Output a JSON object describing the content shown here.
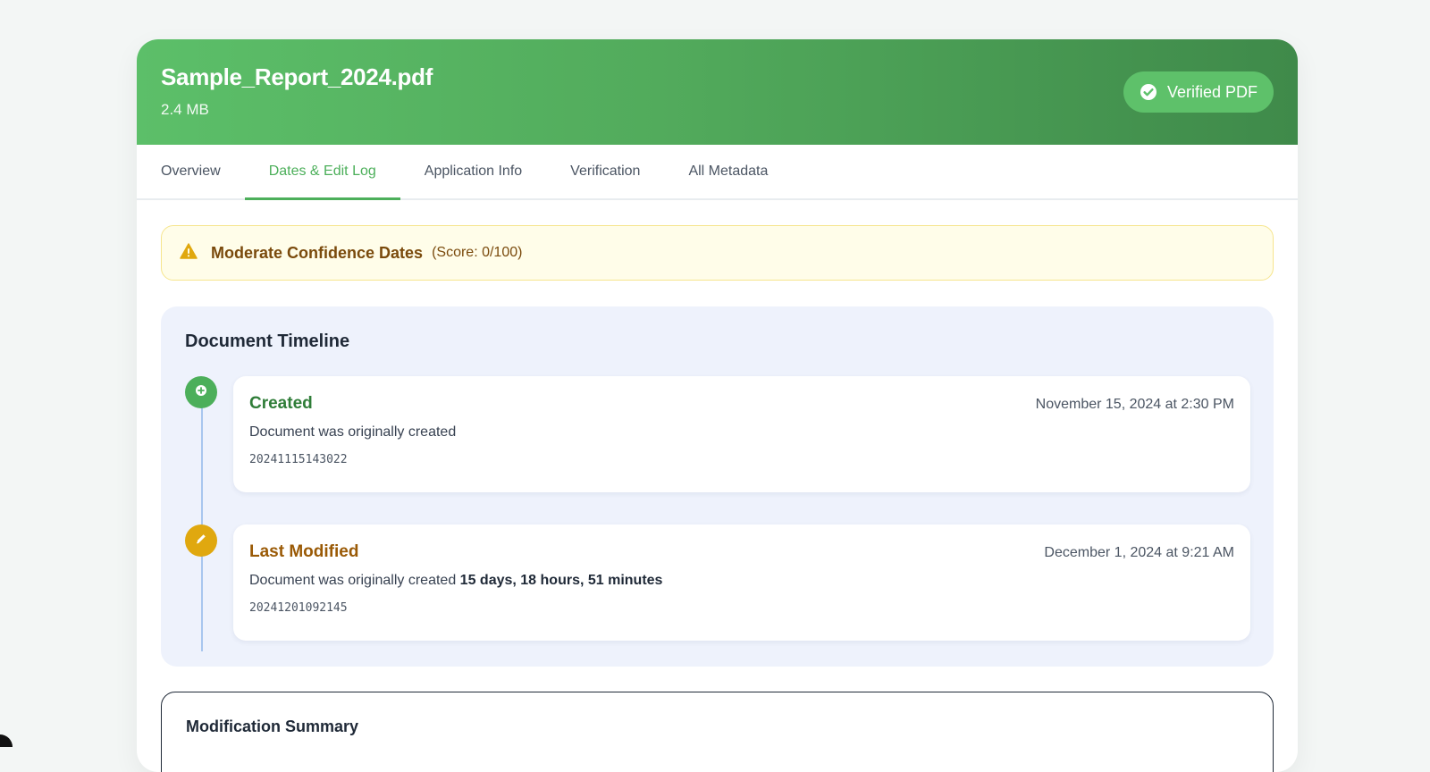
{
  "header": {
    "file_name": "Sample_Report_2024.pdf",
    "file_size": "2.4 MB",
    "badge_label": "Verified PDF",
    "badge_icon": "check-circle-icon",
    "colors": {
      "accent": "#4caf5a",
      "gradient_start": "#5cbf69",
      "gradient_end": "#3f8a4a"
    }
  },
  "tabs": [
    {
      "label": "Overview",
      "active": false
    },
    {
      "label": "Dates & Edit Log",
      "active": true
    },
    {
      "label": "Application Info",
      "active": false
    },
    {
      "label": "Verification",
      "active": false
    },
    {
      "label": "All Metadata",
      "active": false
    }
  ],
  "alert": {
    "icon": "warning-icon",
    "title": "Moderate Confidence Dates",
    "score": "(Score: 0/100)",
    "color": "#7a4a0c"
  },
  "timeline": {
    "heading": "Document Timeline",
    "events": [
      {
        "title": "Created",
        "icon": "plus-circle-icon",
        "date": "November 15, 2024 at 2:30 PM",
        "description": "Document was originally created",
        "description_bold": "",
        "raw": "20241115143022",
        "color": "#4caf5a"
      },
      {
        "title": "Last Modified",
        "icon": "pencil-icon",
        "date": "December 1, 2024 at 9:21 AM",
        "description": "Document was originally created ",
        "description_bold": "15 days, 18 hours, 51 minutes",
        "raw": "20241201092145",
        "color": "#e0a80f"
      }
    ]
  },
  "summary": {
    "title": "Modification Summary"
  }
}
